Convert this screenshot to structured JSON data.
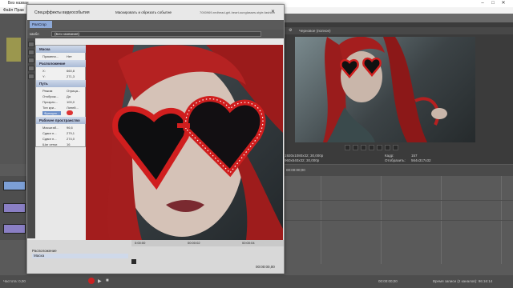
{
  "main": {
    "title": "Без назван",
    "menu": [
      "Файл",
      "Прав"
    ],
    "window_controls": [
      "–",
      "□",
      "✕"
    ]
  },
  "dialog": {
    "title": "Спецэффекты видеособытия",
    "tab_label": "Маскировать и обрезать событие",
    "path_text": "7000969-redhead-girl-heart-sunglasses-style-fashion",
    "chain_tab": "PanCrop",
    "preset_label": "Шабл",
    "preset_value": "(Без названия)",
    "close_btn": "✕",
    "tree": {
      "mask_head": "Маска",
      "mask_rows": [
        {
          "label": "Примени...",
          "value": "Нет"
        }
      ],
      "position_head": "Расположение",
      "position_rows": [
        {
          "label": "X:",
          "value": "660,8"
        },
        {
          "label": "Y:",
          "value": "271,3"
        }
      ],
      "path_head": "Путь",
      "path_rows": [
        {
          "label": "Режим",
          "value": "Отрица..."
        },
        {
          "label": "Отоброж...",
          "value": "Да"
        },
        {
          "label": "Прозрач...",
          "value": "100,0"
        },
        {
          "label": "Тип кри...",
          "value": "Линей..."
        },
        {
          "label": "Функция...",
          "value": ""
        }
      ],
      "workspace_head": "Рабочее пространство",
      "workspace_rows": [
        {
          "label": "Масштаб...",
          "value": "96,6"
        },
        {
          "label": "Сдвиг п...",
          "value": "279,1"
        },
        {
          "label": "Сдвиг п...",
          "value": "274,0"
        },
        {
          "label": "Шаг сетки",
          "value": "16"
        }
      ]
    },
    "timeline": {
      "ticks": [
        "0:00:00",
        "00:00:02",
        "00:00:04"
      ],
      "track_label_1": "Расположение",
      "track_label_2": "Маска",
      "time_readout": "00:00:00,00"
    }
  },
  "preview": {
    "title": "Черновое (полное)",
    "info_left": [
      "1920x1080x32; 30,000р",
      "960x540x32; 30,000р"
    ],
    "info_right_labels": [
      "Кадр:",
      "Отобразить:"
    ],
    "info_right_values": [
      "157",
      "564x317x32"
    ]
  },
  "timeline": {
    "ruler_time": "00:00:00;00",
    "bottom_left": "Частота: 0,00",
    "bottom_time": "00:00:00;00",
    "bottom_record": "Время записи (2 каналов): 96:16:14"
  },
  "colors": {
    "accent_blue": "#6b8fc9",
    "heart_red": "#d01e1e",
    "track_purple": "#8a7fc4"
  }
}
